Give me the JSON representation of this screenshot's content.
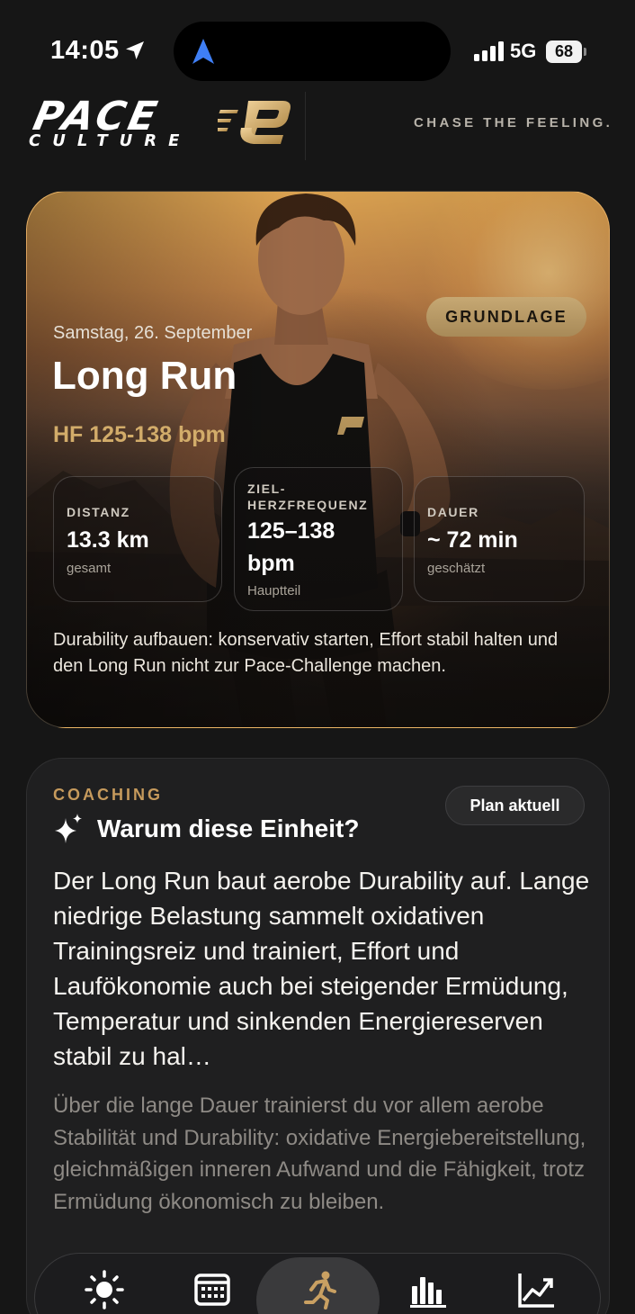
{
  "status_bar": {
    "time": "14:05",
    "network": "5G",
    "battery": "68"
  },
  "header": {
    "brand_line1": "PACE",
    "brand_line2": "CULTURE",
    "tagline": "CHASE THE FEELING."
  },
  "workout": {
    "badge": "GRUNDLAGE",
    "date": "Samstag, 26. September",
    "title": "Long Run",
    "heart_rate": "HF 125-138 bpm",
    "stats": [
      {
        "label": "DISTANZ",
        "value": "13.3 km",
        "sub": "gesamt"
      },
      {
        "label_line1": "ZIEL-",
        "label_line2": "HERZFREQUENZ",
        "value_line1": "125–138",
        "value_line2": "bpm",
        "sub": "Hauptteil"
      },
      {
        "label": "DAUER",
        "value": "~ 72 min",
        "sub": "geschätzt"
      }
    ],
    "description": "Durability aufbauen: konservativ starten, Effort stabil halten und den Long Run nicht zur Pace-Challenge machen."
  },
  "coaching": {
    "eyebrow": "COACHING",
    "plan_pill": "Plan aktuell",
    "title": "Warum diese Einheit?",
    "lead": "Der Long Run baut aerobe Durability auf. Lange niedrige Belastung sammelt oxidativen Trainingsreiz und trainiert, Effort und Laufökonomie auch bei steigender Ermüdung, Temperatur und sinkenden Energiereserven stabil zu hal…",
    "body": "Über die lange Dauer trainierst du vor allem aerobe Stabilität und Durability: oxidative Energiebereitstellung, gleichmäßigen inneren Aufwand und die Fähigkeit, trotz Ermüdung ökonomisch zu bleiben."
  },
  "tabbar": {
    "tabs": [
      {
        "icon": "sun-icon"
      },
      {
        "icon": "calendar-icon"
      },
      {
        "icon": "runner-icon",
        "active": true
      },
      {
        "icon": "bar-chart-icon"
      },
      {
        "icon": "trend-chart-icon"
      }
    ]
  },
  "colors": {
    "accent_gold": "#d2ac6a",
    "eyebrow_gold": "#c69a5c",
    "background": "#161616"
  }
}
